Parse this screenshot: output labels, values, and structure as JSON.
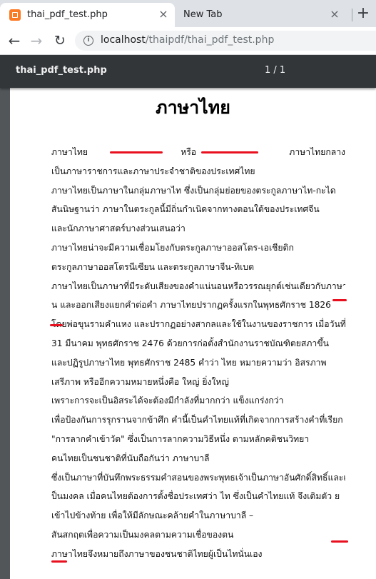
{
  "browser": {
    "tabs": [
      {
        "title": "thai_pdf_test.php",
        "active": true
      },
      {
        "title": "New Tab",
        "active": false
      }
    ],
    "new_tab_symbol": "+",
    "close_symbol": "×",
    "address": {
      "host": "localhost",
      "path": "/thaipdf/thai_pdf_test.php"
    }
  },
  "pdf_viewer": {
    "title": "thai_pdf_test.php",
    "page_indicator": "1 / 1"
  },
  "document": {
    "heading": "ภาษาไทย",
    "lines": [
      "ภาษาไทย|หรือ|ภาษาไทยกลาง",
      "เป็นภาษาราชการและภาษาประจำชาติของประเทศไทย",
      "ภาษาไทยเป็นภาษาในกลุ่มภาษาไท ซึ่งเป็นกลุ่มย่อยของตระกูลภาษาไท-กะได",
      "สันนิษฐานว่า ภาษาในตระกูลนี้มีถิ่นกำเนิดจากทางตอนใต้ของประเทศจีน",
      "และนักภาษาศาสตร์บางส่วนเสนอว่า",
      "ภาษาไทยน่าจะมีความเชื่อมโยงกับตระกูลภาษาออสโตร-เอเชียติก",
      "ตระกูลภาษาออสโตรนีเซียน และตระกูลภาษาจีน-ทิเบต",
      "ภาษาไทยเป็นภาษาที่มีระดับเสียงของคำแน่นอนหรือวรรณยุกต์เช่นเดียวกับภาษาจี",
      "น และออกเสียงแยกคำต่อคำ ภาษาไทยปรากฏครั้งแรกในพุทธศักราช 1826",
      "โดยพ่อขุนรามคำแหง และปรากฏอย่างสากลและใช้ในงานของราชการ เมื่อวันที่",
      "31 มีนาคม พุทธศักราช 2476 ด้วยการก่อตั้งสำนักงานราชบัณฑิตยสภาขึ้น",
      "และปฏิรูปภาษาไทย พุทธศักราช 2485 คำว่า ไทย หมายความว่า อิสรภาพ",
      "เสรีภาพ หรืออีกความหมายหนึ่งคือ ใหญ่ ยิ่งใหญ่",
      "เพราะการจะเป็นอิสระได้จะต้องมีกำลังที่มากกว่า แข็งแกร่งกว่า",
      "เพื่อป้องกันการรุกรานจากข้าศึก คำนี้เป็นคำไทยแท้ที่เกิดจากการสร้างคำที่เรียก",
      "\"การลากคำเข้าวัด\" ซึ่งเป็นการลากความวิธีหนึ่ง ตามหลักคติชนวิทยา",
      "คนไทยเป็นชนชาติที่นับถือกันว่า ภาษาบาลี",
      "ซึ่งเป็นภาษาที่บันทึกพระธรรมคำสอนของพระพุทธเจ้าเป็นภาษาอันศักดิ์สิทธิ์และเ",
      "ป็นมงคล เมื่อคนไทยต้องการตั้งชื่อประเทศว่า ไท ซึ่งเป็นคำไทยแท้ จึงเติมตัว ย",
      "เข้าไปข้างท้าย เพื่อให้มีลักษณะคล้ายคำในภาษาบาลี –",
      "สันสกฤตเพื่อความเป็นมงคลตามความเชื่อของตน",
      "ภาษาไทยจึงหมายถึงภาษาของชนชาติไทยผู้เป็นไทนั่นเอง"
    ]
  },
  "colors": {
    "annotation_red": "#e8101f",
    "pdf_bar": "#323639",
    "viewer_bg": "#525659"
  }
}
